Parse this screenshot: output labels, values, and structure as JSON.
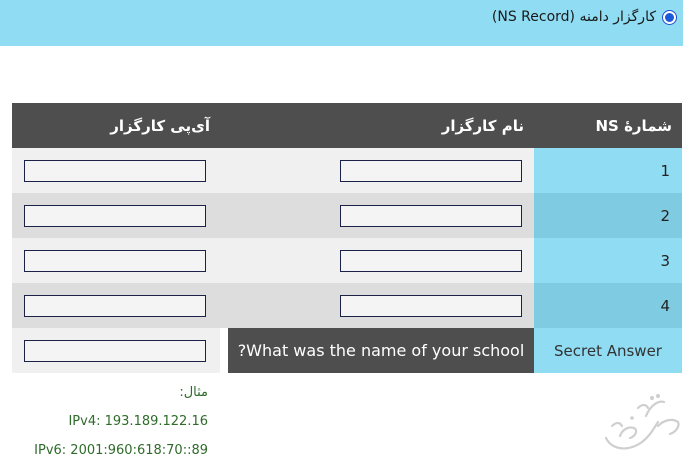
{
  "header": {
    "radio_label": "کارگزار دامنه (NS Record)",
    "radio_selected": true
  },
  "table": {
    "columns": [
      "شمارهٔ NS",
      "نام کارگزار",
      "آی‌پی کارگزار"
    ],
    "rows": [
      {
        "num": "1",
        "name_value": "",
        "ip_value": ""
      },
      {
        "num": "2",
        "name_value": "",
        "ip_value": ""
      },
      {
        "num": "3",
        "name_value": "",
        "ip_value": ""
      },
      {
        "num": "4",
        "name_value": "",
        "ip_value": ""
      }
    ],
    "secret": {
      "label": "Secret Answer",
      "question": "?What was the name of your school",
      "answer_value": ""
    }
  },
  "example": {
    "title": "مثال:",
    "ipv4": "IPv4: 193.189.122.16",
    "ipv6": "IPv6: 2001:960:618:70::89"
  },
  "colors": {
    "header_bg": "#8fdcf3",
    "table_header_bg": "#4e4e4e",
    "example_text": "#2f6b2a"
  },
  "icons": {
    "logo": "calligraphy-logo"
  }
}
